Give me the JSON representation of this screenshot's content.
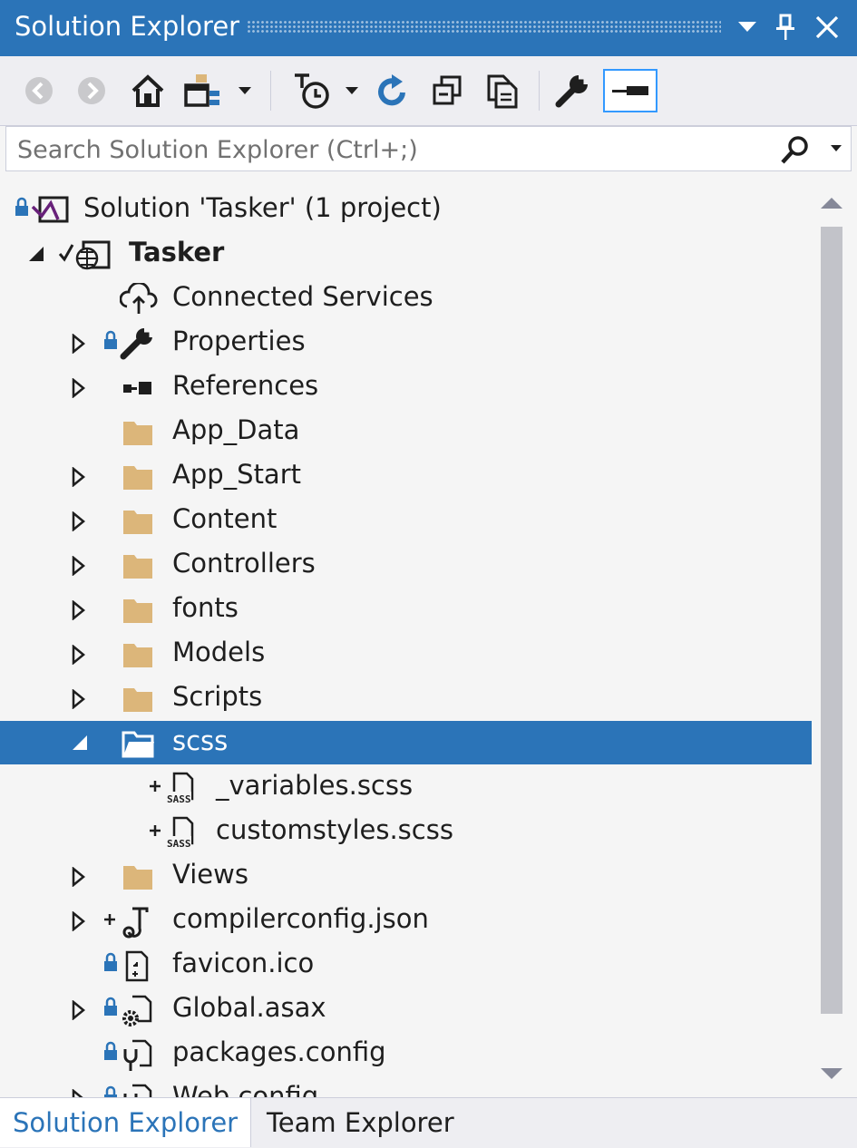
{
  "window": {
    "title": "Solution Explorer",
    "dropdown_icon": "chevron-down-icon",
    "pin_icon": "pin-icon",
    "close_icon": "close-icon"
  },
  "toolbar": {
    "items": [
      "back",
      "forward",
      "home",
      "switch-views",
      "pending-changes-filter",
      "refresh",
      "collapse-all",
      "show-all-files",
      "properties",
      "preview-selected-items"
    ]
  },
  "search": {
    "placeholder": "Search Solution Explorer (Ctrl+;)"
  },
  "tree": {
    "solution": "Solution 'Tasker' (1 project)",
    "project": "Tasker",
    "items": [
      "Connected Services",
      "Properties",
      "References",
      "App_Data",
      "App_Start",
      "Content",
      "Controllers",
      "fonts",
      "Models",
      "Scripts",
      "scss",
      "_variables.scss",
      "customstyles.scss",
      "Views",
      "compilerconfig.json",
      "favicon.ico",
      "Global.asax",
      "packages.config",
      "Web.config"
    ],
    "selected": "scss"
  },
  "tabs": {
    "active": "Solution Explorer",
    "inactive": "Team Explorer"
  },
  "colors": {
    "accent": "#2b74b8",
    "folder": "#dcb67a",
    "background": "#f5f5f5"
  }
}
